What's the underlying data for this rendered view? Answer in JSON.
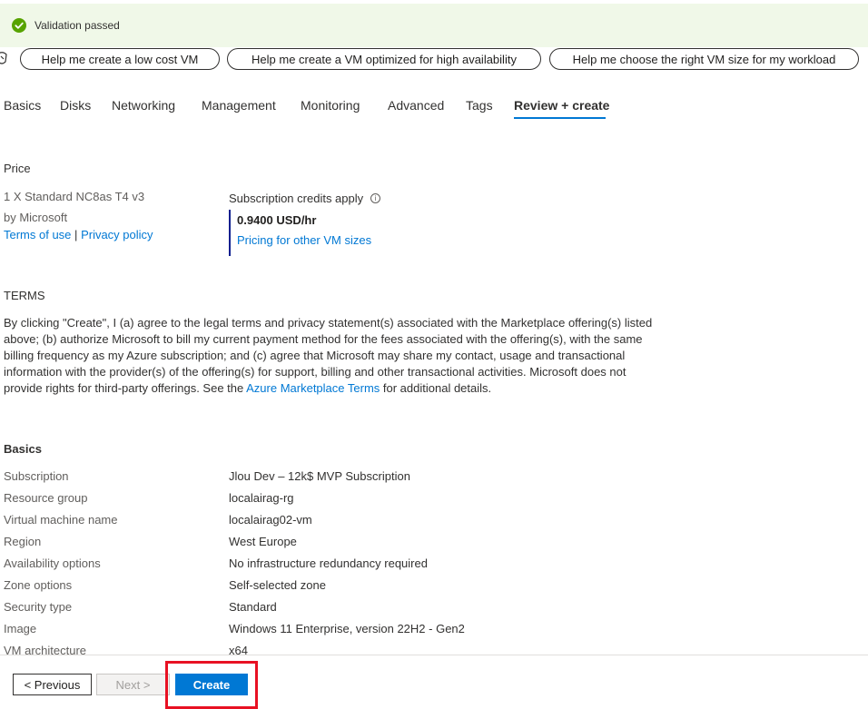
{
  "banner": {
    "text": "Validation passed",
    "color": "#57a300"
  },
  "suggestions": [
    "Help me create a low cost VM",
    "Help me create a VM optimized for high availability",
    "Help me choose the right VM size for my workload"
  ],
  "tabs": [
    {
      "label": "Basics",
      "active": false
    },
    {
      "label": "Disks",
      "active": false
    },
    {
      "label": "Networking",
      "active": false
    },
    {
      "label": "Management",
      "active": false
    },
    {
      "label": "Monitoring",
      "active": false
    },
    {
      "label": "Advanced",
      "active": false
    },
    {
      "label": "Tags",
      "active": false
    },
    {
      "label": "Review + create",
      "active": true
    }
  ],
  "price": {
    "title": "Price",
    "offer": "1 X Standard NC8as T4 v3",
    "by": "by Microsoft",
    "terms_link": "Terms of use",
    "separator": "|",
    "privacy_link": "Privacy policy",
    "credits": "Subscription credits apply",
    "value": "0.9400 USD/hr",
    "pricing_link": "Pricing for other VM sizes"
  },
  "terms": {
    "title": "TERMS",
    "text_before": "By clicking \"Create\", I (a) agree to the legal terms and privacy statement(s) associated with the Marketplace offering(s) listed above; (b) authorize Microsoft to bill my current payment method for the fees associated with the offering(s), with the same billing frequency as my Azure subscription; and (c) agree that Microsoft may share my contact, usage and transactional information with the provider(s) of the offering(s) for support, billing and other transactional activities. Microsoft does not provide rights for third-party offerings. See the ",
    "link": "Azure Marketplace Terms",
    "text_after": " for additional details."
  },
  "basics": {
    "title": "Basics",
    "rows": [
      {
        "label": "Subscription",
        "value": "Jlou Dev – 12k$ MVP Subscription"
      },
      {
        "label": "Resource group",
        "value": "localairag-rg"
      },
      {
        "label": "Virtual machine name",
        "value": "localairag02-vm"
      },
      {
        "label": "Region",
        "value": "West Europe"
      },
      {
        "label": "Availability options",
        "value": "No infrastructure redundancy required"
      },
      {
        "label": "Zone options",
        "value": "Self-selected zone"
      },
      {
        "label": "Security type",
        "value": "Standard"
      },
      {
        "label": "Image",
        "value": "Windows 11 Enterprise, version 22H2 - Gen2"
      },
      {
        "label": "VM architecture",
        "value": "x64"
      }
    ]
  },
  "footer": {
    "previous": "< Previous",
    "next": "Next >",
    "create": "Create",
    "accent": "#0078d4",
    "highlight_color": "#e81123"
  }
}
